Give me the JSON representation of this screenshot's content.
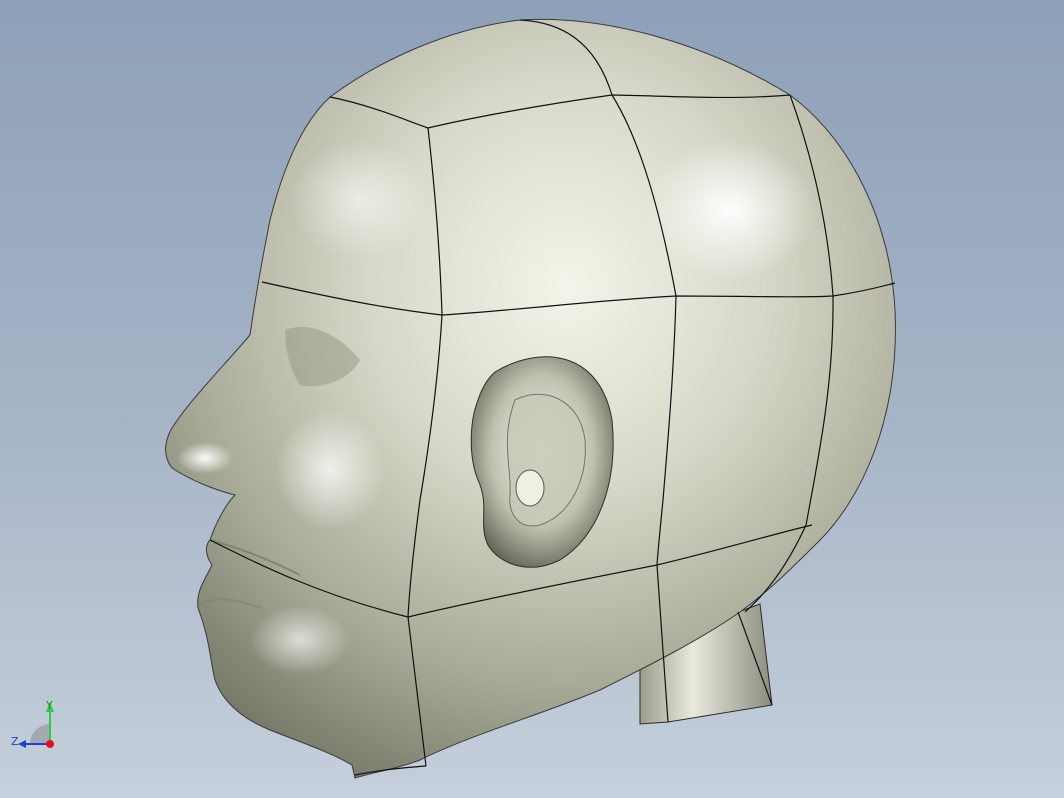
{
  "viewport": {
    "background_top": "#8ea0b8",
    "background_bottom": "#c6d0dc"
  },
  "model": {
    "kind": "head-surface-model",
    "surface_color": "#c8cab8",
    "edge_color": "#1a1a1a"
  },
  "triad": {
    "y_label": "Y",
    "z_label": "Z",
    "y_color": "#2ecc40",
    "z_color": "#1f3fd1",
    "x_color": "#e8101a"
  }
}
